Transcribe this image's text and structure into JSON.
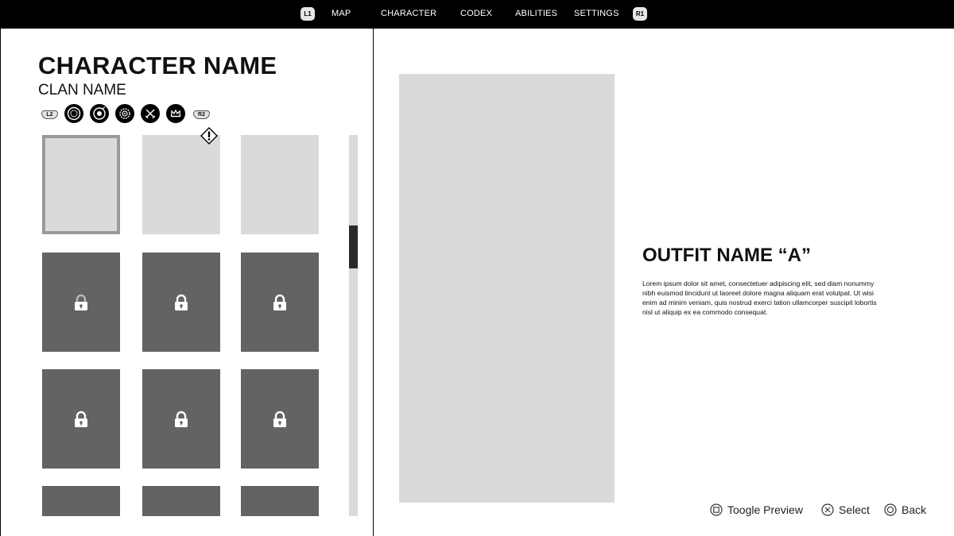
{
  "nav": {
    "left_bumper": "L1",
    "right_bumper": "R1",
    "items": [
      "MAP",
      "CHARACTER",
      "CODEX",
      "ABILITIES",
      "SETTINGS"
    ]
  },
  "character": {
    "name": "CHARACTER NAME",
    "clan": "CLAN NAME"
  },
  "categories": {
    "left_bumper": "L2",
    "right_bumper": "R2",
    "icons": [
      "compass-icon",
      "target-icon",
      "gear-badge-icon",
      "crossed-swords-icon",
      "crown-icon"
    ]
  },
  "outfits": {
    "tiles": [
      {
        "state": "selected",
        "locked": false
      },
      {
        "state": "new",
        "locked": false
      },
      {
        "state": "normal",
        "locked": false
      },
      {
        "state": "normal",
        "locked": true
      },
      {
        "state": "normal",
        "locked": true
      },
      {
        "state": "normal",
        "locked": true
      },
      {
        "state": "normal",
        "locked": true
      },
      {
        "state": "normal",
        "locked": true
      },
      {
        "state": "normal",
        "locked": true
      },
      {
        "state": "normal",
        "locked": true
      },
      {
        "state": "normal",
        "locked": true
      },
      {
        "state": "normal",
        "locked": true
      }
    ]
  },
  "detail": {
    "title": "OUTFIT NAME “A”",
    "description": "Lorem ipsum dolor sit amet, consectetuer adipiscing elit, sed diam nonummy nibh euismod tincidunt ut laoreet dolore magna aliquam erat volutpat. Ut wisi enim ad minim veniam, quis nostrud exerci tation ullamcorper suscipit lobortis nisl ut aliquip ex ea commodo consequat."
  },
  "hints": {
    "toggle_preview": "Toogle Preview",
    "select": "Select",
    "back": "Back"
  },
  "colors": {
    "topbar": "#000000",
    "tile_unlocked": "#dadada",
    "tile_locked": "#636363",
    "selected_border": "#9a9a9a"
  }
}
